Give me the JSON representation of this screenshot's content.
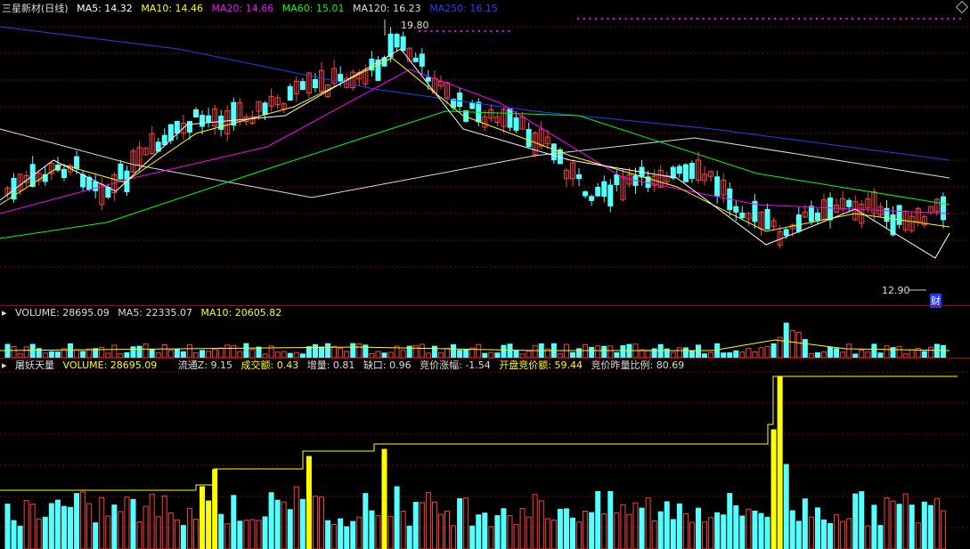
{
  "main_legend": {
    "title": "三星新材(日线)",
    "ma5": {
      "label": "MA5: 14.32",
      "color": "#ffffff"
    },
    "ma10": {
      "label": "MA10: 14.46",
      "color": "#ffff00"
    },
    "ma20": {
      "label": "MA20: 14.66",
      "color": "#ff00ff"
    },
    "ma60": {
      "label": "MA60: 15.01",
      "color": "#00ff00"
    },
    "ma120": {
      "label": "MA120: 16.23",
      "color": "#dddddd"
    },
    "ma250": {
      "label": "MA250: 16.15",
      "color": "#2a3cff"
    }
  },
  "price_annotations": {
    "high": "19.80",
    "low": "12.90",
    "badge": "财"
  },
  "volume_legend": {
    "volume": "VOLUME: 28695.09",
    "ma5": "MA5: 22335.07",
    "ma10": "MA10: 20605.82"
  },
  "indicator_legend": {
    "name": "屠妖天量",
    "items": [
      {
        "label": "VOLUME: 28695.09",
        "color": "#ffff00"
      },
      {
        "label": "流通Z: 9.15",
        "color": "#dddddd"
      },
      {
        "label": "成交额: 0.43",
        "color": "#ffff00"
      },
      {
        "label": "增量: 0.81",
        "color": "#dddddd"
      },
      {
        "label": "缺口: 0.96",
        "color": "#dddddd"
      },
      {
        "label": "竞价涨幅: -1.54",
        "color": "#dddddd"
      },
      {
        "label": "开盘竞价额: 59.44",
        "color": "#ffff00"
      },
      {
        "label": "竞价昨量比例: 80.69",
        "color": "#dddddd"
      }
    ]
  },
  "colors": {
    "up": "#ff4040",
    "down": "#54ffff",
    "grid": "#8b0000",
    "highlight": "#ffff00"
  }
}
